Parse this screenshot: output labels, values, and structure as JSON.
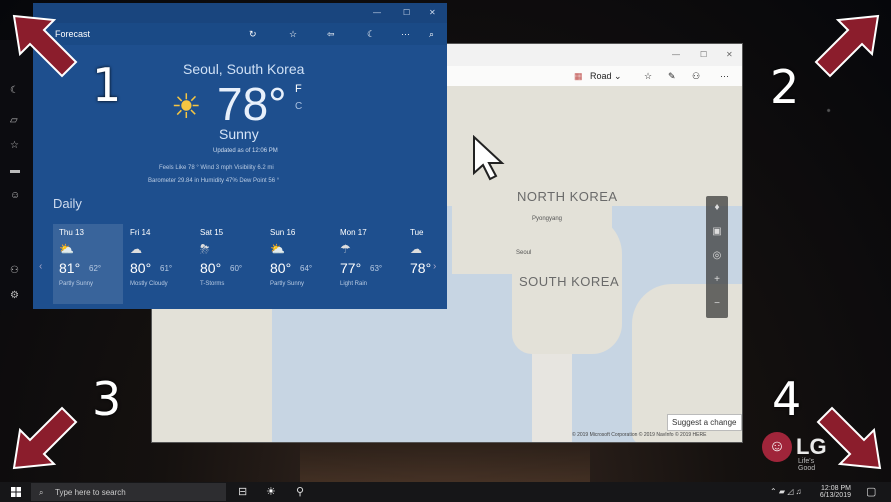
{
  "maps": {
    "view_mode": "Road",
    "country_labels": [
      "NORTH KOREA",
      "SOUTH KOREA"
    ],
    "cities": [
      "Pyongyang",
      "Seoul"
    ],
    "suggest_change": "Suggest a change",
    "copyright": "© 2019 Microsoft Corporation © 2019 NavInfo © 2019 HERE"
  },
  "weather": {
    "title": "Forecast",
    "location": "Seoul, South Korea",
    "temperature": "78",
    "degree": "°",
    "unit_f": "F",
    "unit_c": "C",
    "condition": "Sunny",
    "updated": "Updated as of 12:06 PM",
    "details_row1": "Feels Like  78 °     Wind  3 mph     Visibility  6.2 mi",
    "details_row2": "Barometer  29.84 in     Humidity  47%     Dew Point  56 °",
    "daily_label": "Daily",
    "forecast": [
      {
        "day": "Thu 13",
        "hi": "81°",
        "lo": "62°",
        "cond": "Partly Sunny"
      },
      {
        "day": "Fri 14",
        "hi": "80°",
        "lo": "61°",
        "cond": "Mostly Cloudy"
      },
      {
        "day": "Sat 15",
        "hi": "80°",
        "lo": "60°",
        "cond": "T-Storms"
      },
      {
        "day": "Sun 16",
        "hi": "80°",
        "lo": "64°",
        "cond": "Partly Sunny"
      },
      {
        "day": "Mon 17",
        "hi": "77°",
        "lo": "63°",
        "cond": "Light Rain"
      },
      {
        "day": "Tue",
        "hi": "78°",
        "lo": "",
        "cond": ""
      }
    ]
  },
  "callouts": [
    "1",
    "2",
    "3",
    "4"
  ],
  "brand": {
    "name": "LG",
    "tagline": "Life's Good"
  },
  "taskbar": {
    "search_placeholder": "Type here to search",
    "time": "12:08 PM",
    "date": "6/13/2019"
  },
  "colors": {
    "arrow": "#8b1d2c",
    "weather_bg": "#1e4f8e",
    "map_sea": "#c7d5e3"
  }
}
